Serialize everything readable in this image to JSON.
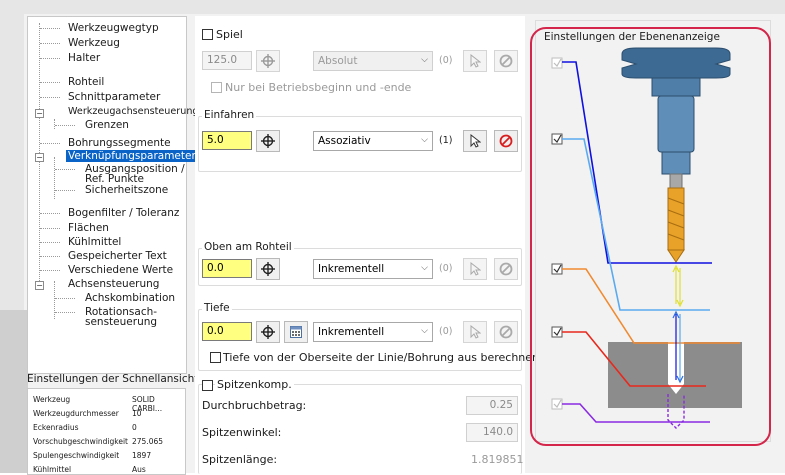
{
  "tree": {
    "items": [
      {
        "label": "Werkzeugwegtyp"
      },
      {
        "label": "Werkzeug"
      },
      {
        "label": "Halter"
      },
      {
        "label": "Rohteil"
      },
      {
        "label": "Schnittparameter"
      },
      {
        "label": "Werkzeugachsensteuerung"
      },
      {
        "label": "Grenzen"
      },
      {
        "label": "Bohrungssegmente"
      },
      {
        "label": "Verknüpfungsparameter"
      },
      {
        "label": "Ausgangsposition /"
      },
      {
        "label": "Ref. Punkte"
      },
      {
        "label": "Sicherheitszone"
      },
      {
        "label": "Bogenfilter / Toleranz"
      },
      {
        "label": "Flächen"
      },
      {
        "label": "Kühlmittel"
      },
      {
        "label": "Gespeicherter Text"
      },
      {
        "label": "Verschiedene Werte"
      },
      {
        "label": "Achsensteuerung"
      },
      {
        "label": "Achskombination"
      },
      {
        "label": "Rotationsach-"
      },
      {
        "label": "sensteuerung"
      }
    ],
    "expander_symbol": "−"
  },
  "quickview": {
    "title": "Einstellungen der Schnellansicht",
    "rows": [
      {
        "k": "Werkzeug",
        "v": "SOLID CARBI..."
      },
      {
        "k": "Werkzeugdurchmesser",
        "v": "10"
      },
      {
        "k": "Eckenradius",
        "v": "0"
      },
      {
        "k": "Vorschubgeschwindigkeit",
        "v": "275.065"
      },
      {
        "k": "Spulengeschwindigkeit",
        "v": "1897"
      },
      {
        "k": "Kühlmittel",
        "v": "Aus"
      }
    ]
  },
  "spiel": {
    "label": "Spiel",
    "value": "125.0",
    "combo": "Absolut",
    "count": "(0)",
    "nur_label": "Nur bei Betriebsbeginn und -ende"
  },
  "einfahren": {
    "label": "Einfahren",
    "value": "5.0",
    "combo": "Assoziativ",
    "count": "(1)"
  },
  "oben": {
    "label": "Oben am Rohteil",
    "value": "0.0",
    "combo": "Inkrementell",
    "count": "(0)"
  },
  "tiefe": {
    "label": "Tiefe",
    "value": "0.0",
    "combo": "Inkrementell",
    "count": "(0)",
    "cb_label": "Tiefe von der Oberseite der Linie/Bohrung aus berechnen"
  },
  "spitze": {
    "label": "Spitzenkomp.",
    "durchbruch_label": "Durchbruchbetrag:",
    "durchbruch_value": "0.25",
    "winkel_label": "Spitzenwinkel:",
    "winkel_value": "140.0",
    "laenge_label": "Spitzenlänge:",
    "laenge_value": "1.819851"
  },
  "ebenen": {
    "title": "Einstellungen der Ebenenanzeige"
  },
  "colors": {
    "blue": "#1010e0",
    "lightblue": "#5aaaf0",
    "orange": "#f08a30",
    "red": "#e8281c",
    "purple": "#8a2be2",
    "highlight": "#d4264a",
    "selection": "#0a64c8"
  }
}
